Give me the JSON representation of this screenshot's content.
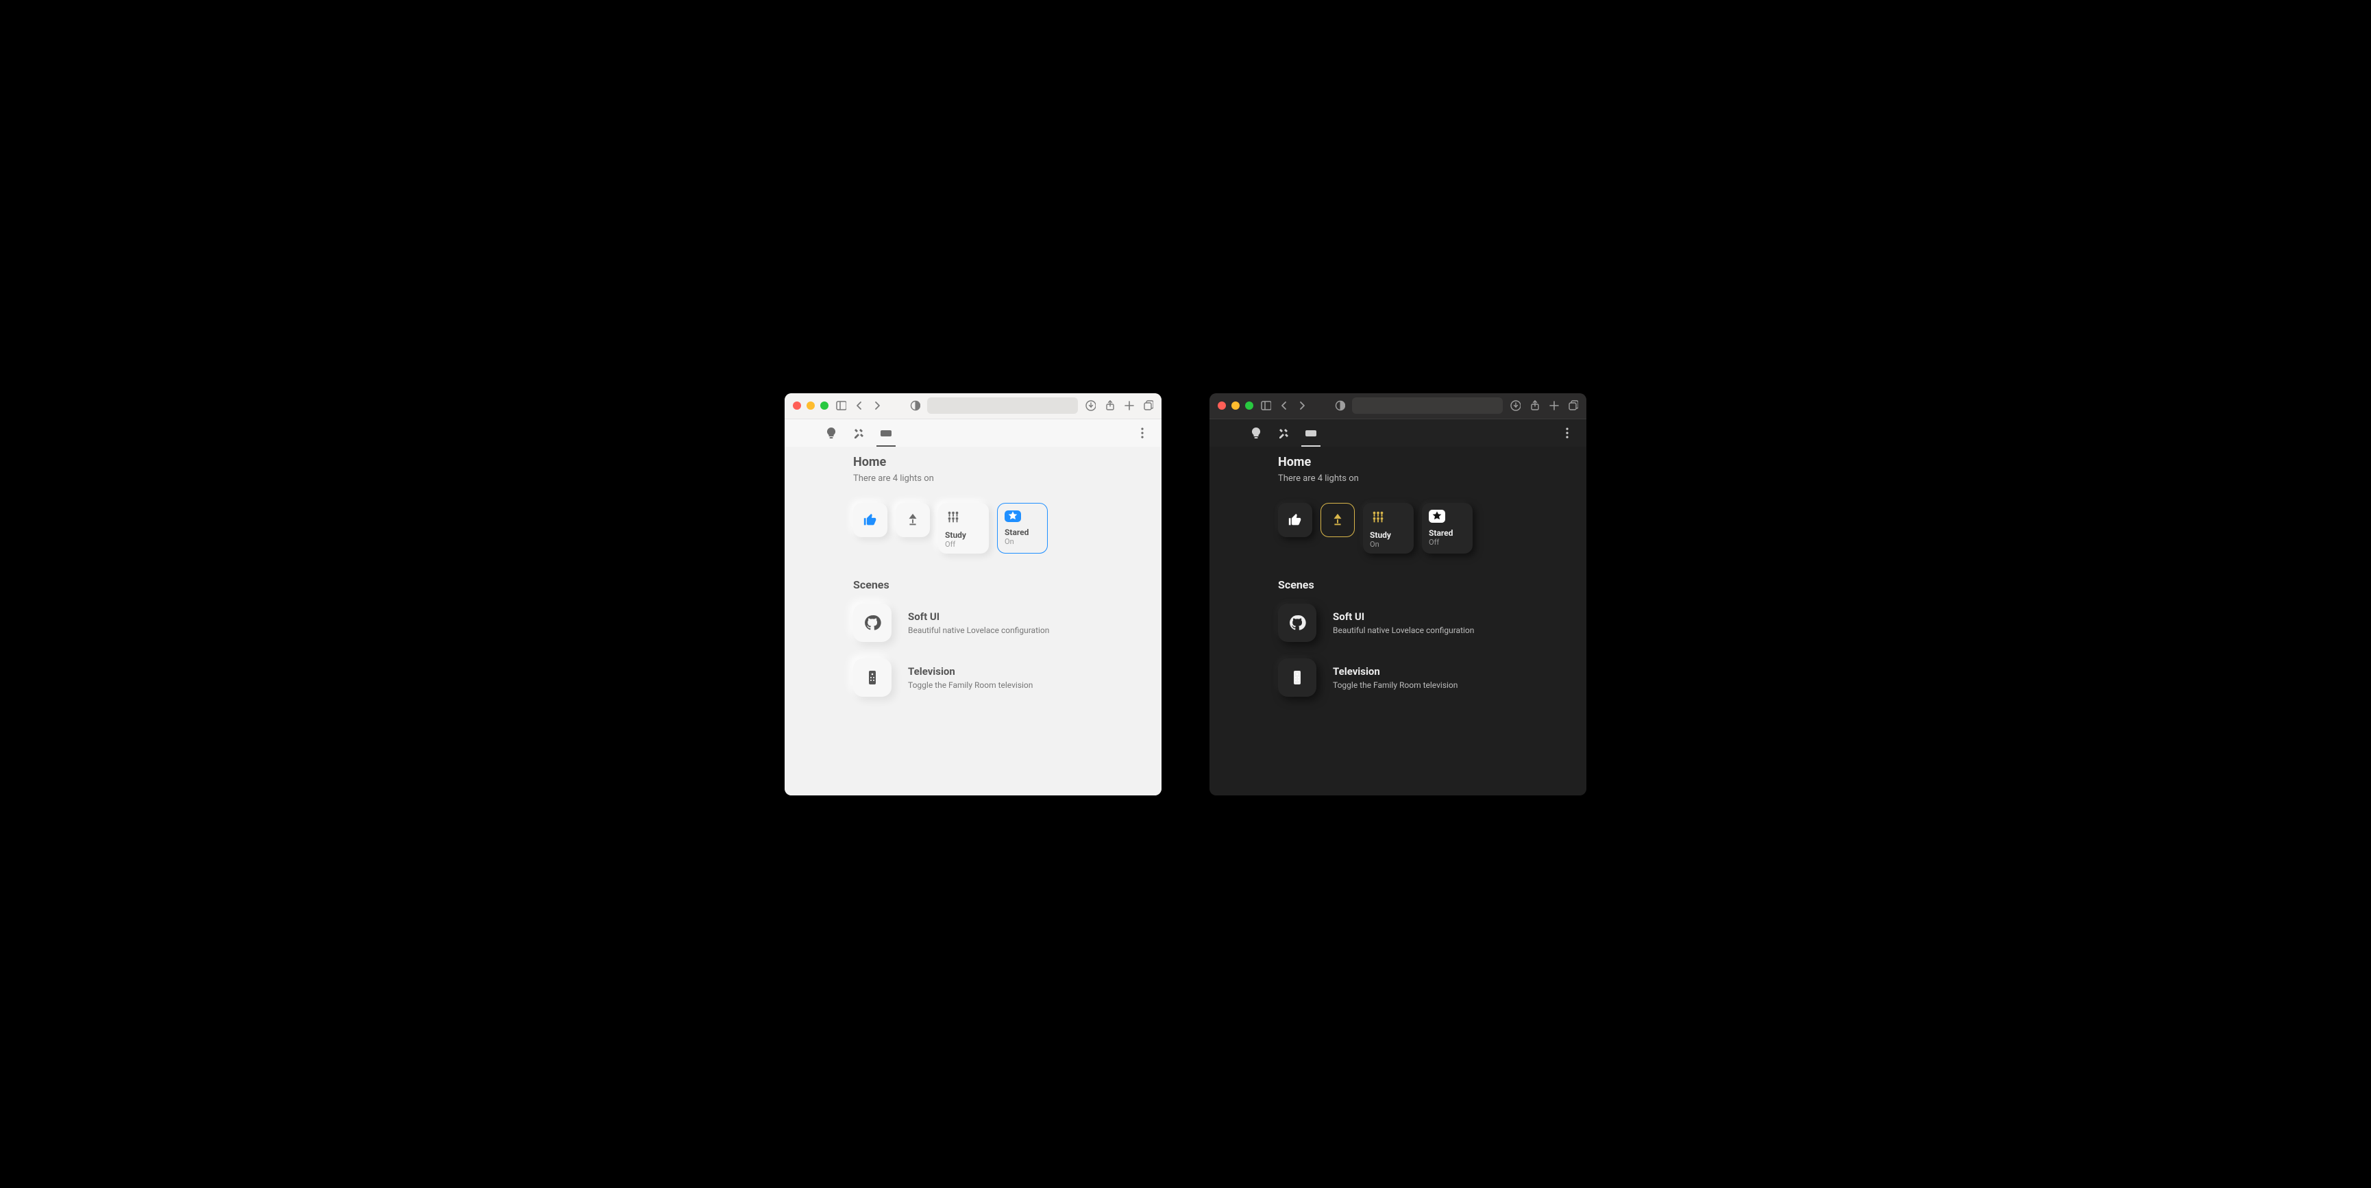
{
  "light": {
    "header_title": "Home",
    "header_sub": "There are 4 lights on",
    "tiles": {
      "study": {
        "label": "Study",
        "state": "Off"
      },
      "stared": {
        "label": "Stared",
        "state": "On"
      }
    },
    "scenes_heading": "Scenes",
    "rows": {
      "softui": {
        "title": "Soft UI",
        "desc": "Beautiful native Lovelace configuration"
      },
      "tv": {
        "title": "Television",
        "desc": "Toggle the Family Room television"
      }
    }
  },
  "dark": {
    "header_title": "Home",
    "header_sub": "There are 4 lights on",
    "tiles": {
      "study": {
        "label": "Study",
        "state": "On"
      },
      "stared": {
        "label": "Stared",
        "state": "Off"
      }
    },
    "scenes_heading": "Scenes",
    "rows": {
      "softui": {
        "title": "Soft UI",
        "desc": "Beautiful native Lovelace configuration"
      },
      "tv": {
        "title": "Television",
        "desc": "Toggle the Family Room television"
      }
    }
  }
}
